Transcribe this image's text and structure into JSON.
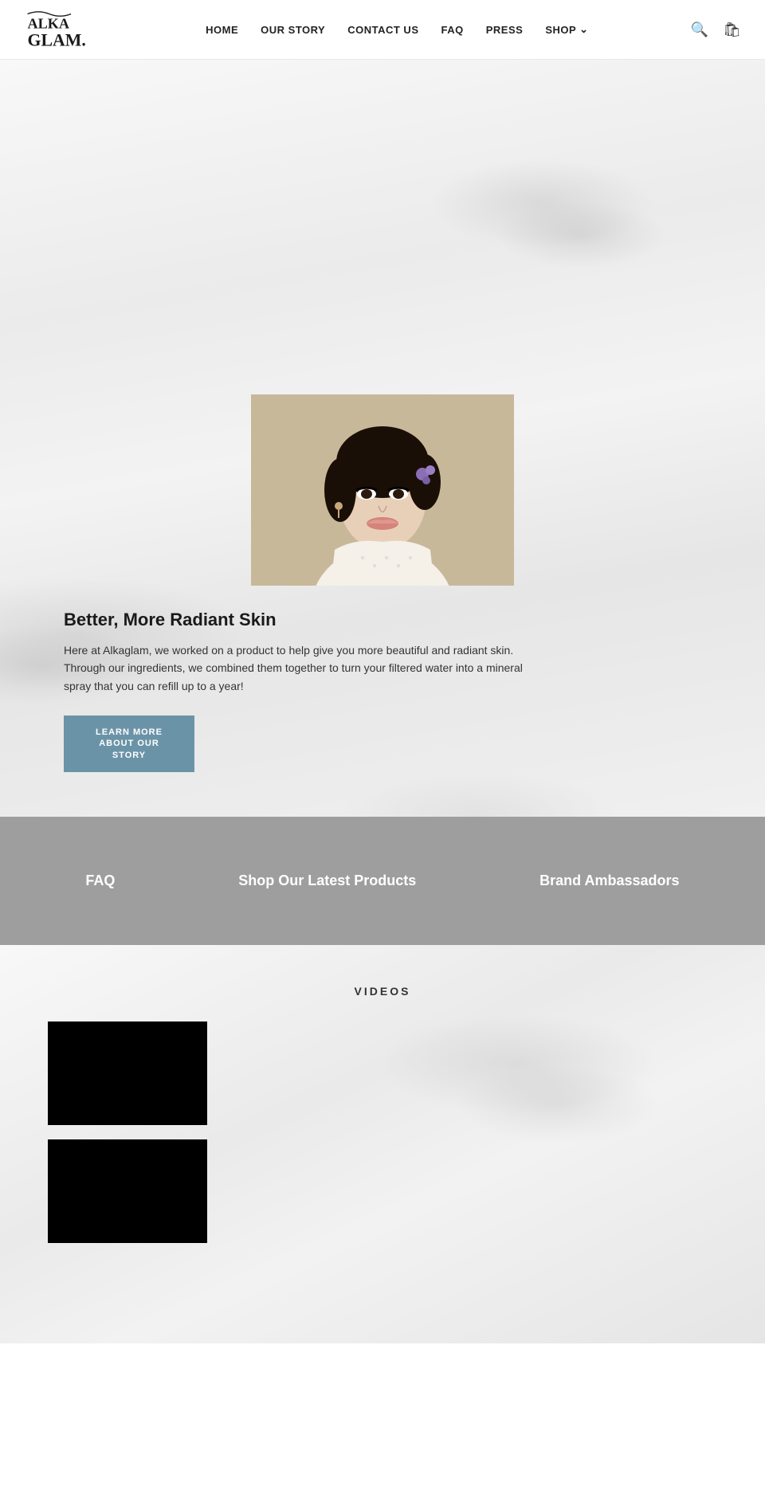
{
  "header": {
    "logo_line1": "ALKA",
    "logo_line2": "GLAM",
    "nav_items": [
      {
        "label": "HOME",
        "id": "home"
      },
      {
        "label": "OUR STORY",
        "id": "our-story"
      },
      {
        "label": "CONTACT US",
        "id": "contact-us"
      },
      {
        "label": "FAQ",
        "id": "faq"
      },
      {
        "label": "PRESS",
        "id": "press"
      },
      {
        "label": "SHOP",
        "id": "shop",
        "has_dropdown": true
      }
    ]
  },
  "hero": {
    "heading": "Better, More Radiant Skin",
    "body_text": "Here at Alkaglam, we worked on a product to help give you more beautiful and radiant skin. Through our ingredients, we combined them together to turn your filtered water into a mineral spray that you can refill up to a year!",
    "cta_button": "LEARN MORE ABOUT OUR STORY"
  },
  "gray_section": {
    "items": [
      {
        "label": "FAQ"
      },
      {
        "label": "Shop Our Latest Products"
      },
      {
        "label": "Brand Ambassadors"
      }
    ]
  },
  "videos_section": {
    "title": "VIDEOS",
    "videos": [
      {
        "id": "video-1"
      },
      {
        "id": "video-2"
      }
    ]
  }
}
